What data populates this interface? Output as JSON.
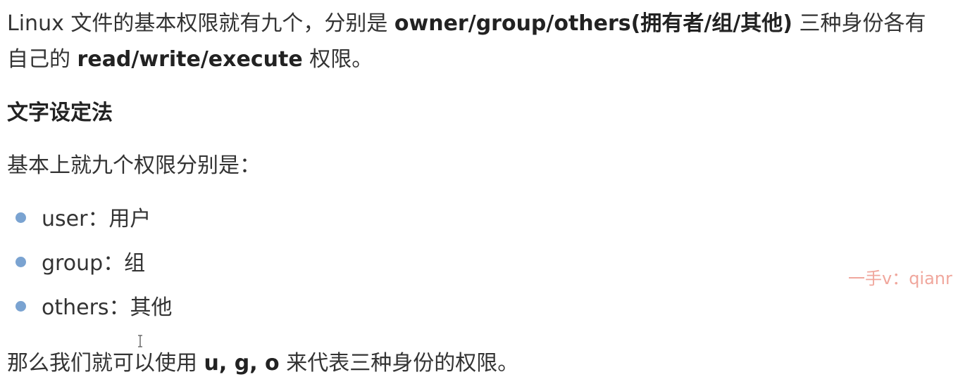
{
  "intro": {
    "part1": "Linux 文件的基本权限就有九个，分别是 ",
    "bold1": "owner/group/others(拥有者/组/其他)",
    "part2": " 三种身份各有自己的 ",
    "bold2": "read/write/execute",
    "part3": " 权限。"
  },
  "heading": "文字设定法",
  "subtext": "基本上就九个权限分别是：",
  "list": [
    "user：用户",
    "group：组",
    "others：其他"
  ],
  "conclusion": {
    "part1": "那么我们就可以使用 ",
    "bold": "u, g, o",
    "part2": " 来代表三种身份的权限。"
  },
  "watermark": "一手v：qianr",
  "colors": {
    "text": "#333333",
    "bullet": "#7aa3d1",
    "watermark": "#f0a79d"
  }
}
